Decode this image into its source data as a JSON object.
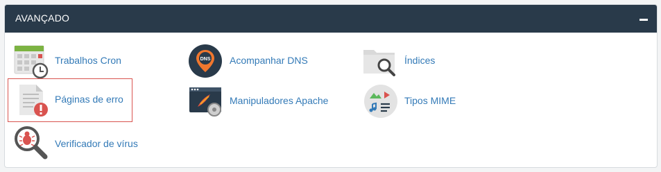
{
  "section": {
    "title": "AVANÇADO",
    "collapse_symbol": "minus-icon"
  },
  "items": [
    {
      "label": "Trabalhos Cron",
      "icon": "calendar-clock-icon"
    },
    {
      "label": "Acompanhar DNS",
      "icon": "dns-pin-icon"
    },
    {
      "label": "Índices",
      "icon": "folder-search-icon"
    },
    {
      "label": "Páginas de erro",
      "icon": "error-page-icon"
    },
    {
      "label": "Manipuladores Apache",
      "icon": "apache-handlers-icon"
    },
    {
      "label": "Tipos MIME",
      "icon": "mime-types-icon"
    },
    {
      "label": "Verificador de vírus",
      "icon": "virus-scanner-icon"
    }
  ],
  "colors": {
    "header_bg": "#293a4a",
    "link": "#337ab7",
    "highlight_border": "#d9534f"
  }
}
